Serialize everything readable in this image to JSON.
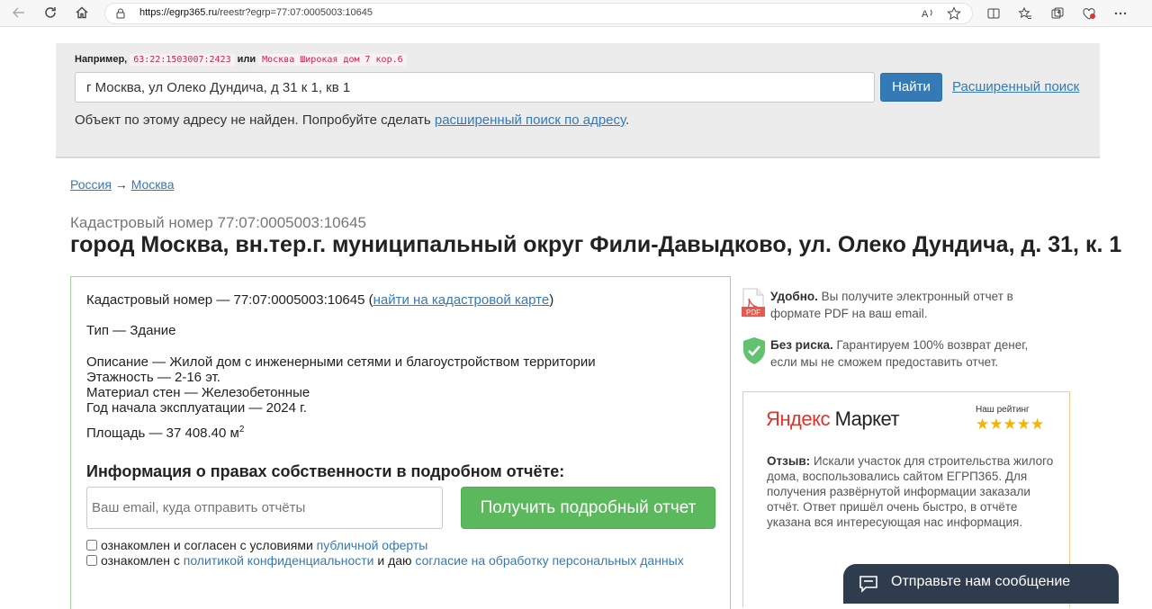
{
  "browser": {
    "url_host": "https://egrp365.ru",
    "url_path": "/reestr?egrp=77:07:0005003:10645"
  },
  "search": {
    "example_label": "Например,",
    "example_code1": "63:22:1503007:2423",
    "example_or": "или",
    "example_code2": "Москва Широкая дом 7 кор.6",
    "input_value": "г Москва, ул Олеко Дундича, д 31 к 1, кв 1",
    "find_label": "Найти",
    "advanced_label": "Расширенный поиск",
    "not_found_text": "Объект по этому адресу не найден. Попробуйте сделать ",
    "not_found_link": "расширенный поиск по адресу",
    "not_found_end": "."
  },
  "breadcrumb": {
    "item1": "Россия",
    "sep": " → ",
    "item2": "Москва"
  },
  "header": {
    "cadastral_sub": "Кадастровый номер 77:07:0005003:10645",
    "title": "город Москва, вн.тер.г. муниципальный округ Фили-Давыдково, ул. Олеко Дундича, д. 31, к. 1"
  },
  "object": {
    "cadastral_line": "Кадастровый номер — 77:07:0005003:10645 (",
    "map_link": "найти на кадастровой карте",
    "cadastral_close": ")",
    "type": "Тип — Здание",
    "description": "Описание — Жилой дом с инженерными сетями и благоустройством территории",
    "floors": "Этажность — 2-16 эт.",
    "walls": "Материал стен — Железобетонные",
    "year": "Год начала эксплуатации — 2024 г.",
    "area": "Площадь — 37 408.40 м",
    "area_sup": "2"
  },
  "rights": {
    "title": "Информация о правах собственности в подробном отчёте:",
    "email_placeholder": "Ваш email, куда отправить отчёты",
    "report_button": "Получить подробный отчет",
    "check1_text": "ознакомлен и согласен с условиями ",
    "check1_link": "публичной оферты",
    "check2_text": "ознакомлен с ",
    "check2_link1": "политикой конфиденциальности",
    "check2_mid": " и даю ",
    "check2_link2": "согласие на обработку персональных данных"
  },
  "features": {
    "pdf_bold": "Удобно.",
    "pdf_text": " Вы получите электронный отчет в формате PDF на ваш email.",
    "pdf_icon_label": "PDF",
    "risk_bold": "Без риска.",
    "risk_text": " Гарантируем 100% возврат денег, если мы не сможем предоставить отчет."
  },
  "market": {
    "logo_part1": "Яндекс",
    "logo_part2": "Маркет",
    "rating_label": "Наш рейтинг",
    "stars": "★★★★★",
    "review_bold": "Отзыв:",
    "review_text": " Искали участок для строительства жилого дома, воспользовались сайтом ЕГРП365. Для получения развёрнутой информации заказали отчёт. Ответ пришёл очень быстро, в отчёте указана вся интересующая нас информация."
  },
  "chat": {
    "label": "Отправьте нам сообщение"
  },
  "colors": {
    "link": "#337ab7",
    "primary_button": "#337ab7",
    "success_button": "#5cb85c",
    "chat_bg": "#2f3c4d"
  }
}
